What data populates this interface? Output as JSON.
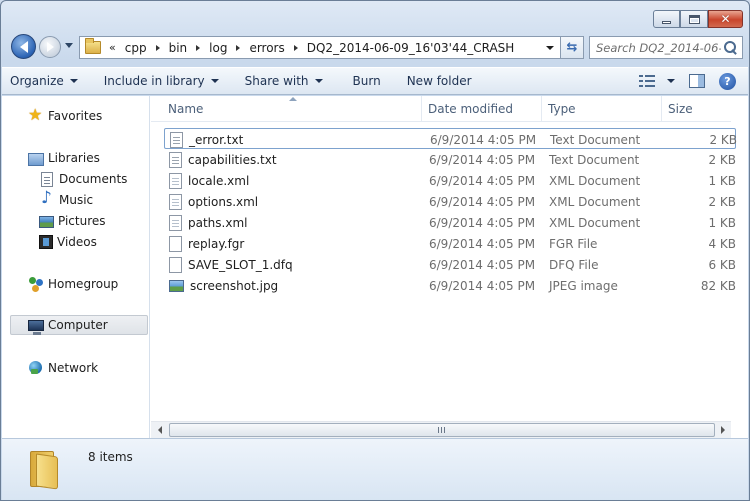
{
  "window": {
    "caption_min": "minimize",
    "caption_max": "maximize",
    "caption_close": "✕"
  },
  "address": {
    "overflow": "«",
    "crumbs": [
      "cpp",
      "bin",
      "log",
      "errors",
      "DQ2_2014-06-09_16'03'44_CRASH"
    ]
  },
  "search": {
    "placeholder": "Search DQ2_2014-06-..."
  },
  "toolbar": {
    "organize": "Organize",
    "include_in_library": "Include in library",
    "share_with": "Share with",
    "burn": "Burn",
    "new_folder": "New folder",
    "help": "?"
  },
  "sidebar": {
    "favorites": "Favorites",
    "libraries": "Libraries",
    "documents": "Documents",
    "music": "Music",
    "pictures": "Pictures",
    "videos": "Videos",
    "homegroup": "Homegroup",
    "computer": "Computer",
    "network": "Network"
  },
  "columns": {
    "name": "Name",
    "date_modified": "Date modified",
    "type": "Type",
    "size": "Size"
  },
  "files": [
    {
      "name": "_error.txt",
      "date": "6/9/2014 4:05 PM",
      "type": "Text Document",
      "size": "2 KB",
      "icon": "text-file-icon"
    },
    {
      "name": "capabilities.txt",
      "date": "6/9/2014 4:05 PM",
      "type": "Text Document",
      "size": "2 KB",
      "icon": "text-file-icon"
    },
    {
      "name": "locale.xml",
      "date": "6/9/2014 4:05 PM",
      "type": "XML Document",
      "size": "1 KB",
      "icon": "xml-file-icon"
    },
    {
      "name": "options.xml",
      "date": "6/9/2014 4:05 PM",
      "type": "XML Document",
      "size": "2 KB",
      "icon": "xml-file-icon"
    },
    {
      "name": "paths.xml",
      "date": "6/9/2014 4:05 PM",
      "type": "XML Document",
      "size": "1 KB",
      "icon": "xml-file-icon"
    },
    {
      "name": "replay.fgr",
      "date": "6/9/2014 4:05 PM",
      "type": "FGR File",
      "size": "4 KB",
      "icon": "blank-file-icon"
    },
    {
      "name": "SAVE_SLOT_1.dfq",
      "date": "6/9/2014 4:05 PM",
      "type": "DFQ File",
      "size": "6 KB",
      "icon": "blank-file-icon"
    },
    {
      "name": "screenshot.jpg",
      "date": "6/9/2014 4:05 PM",
      "type": "JPEG image",
      "size": "82 KB",
      "icon": "image-file-icon"
    }
  ],
  "details": {
    "count": "8 items"
  }
}
